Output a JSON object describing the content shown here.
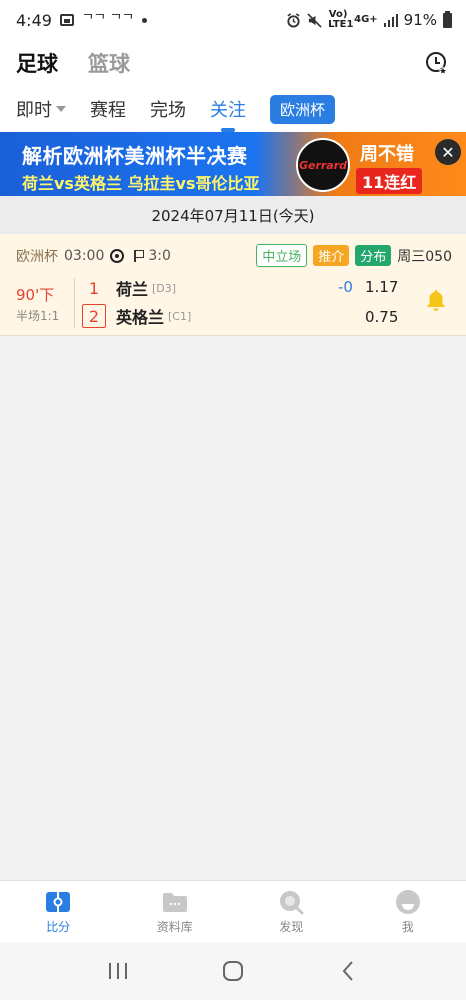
{
  "status_bar": {
    "time": "4:49",
    "carrier_label": "ᄀᄀ ᄀᄀ",
    "battery": "91%",
    "network_volte": "Vo) LTE1",
    "network_4g": "4G+"
  },
  "top_nav": {
    "tabs": [
      {
        "label": "足球"
      },
      {
        "label": "篮球"
      }
    ]
  },
  "sub_tabs": {
    "tabs": [
      {
        "label": "即时"
      },
      {
        "label": "赛程"
      },
      {
        "label": "完场"
      },
      {
        "label": "关注"
      }
    ],
    "chip": "欧洲杯"
  },
  "banner": {
    "line1": "解析欧洲杯美洲杯半决赛",
    "line2": "荷兰vs英格兰 乌拉圭vs哥伦比亚",
    "logo_text": "Gerrard",
    "right1": "周不错",
    "right2": "11连红"
  },
  "date_header": "2024年07月11日(今天)",
  "match": {
    "league": "欧洲杯",
    "time": "03:00",
    "corners": "3:0",
    "badges": [
      "中立场",
      "推介",
      "分布"
    ],
    "match_no": "周三050",
    "minute": "90'下",
    "halftime": "半场1:1",
    "home": {
      "score": "1",
      "name": "荷兰",
      "rank": "[D3]"
    },
    "away": {
      "score": "2",
      "name": "英格兰",
      "rank": "[C1]"
    },
    "handicap": "-0",
    "odds_home": "1.17",
    "odds_away": "0.75"
  },
  "bottom_nav": {
    "items": [
      {
        "label": "比分"
      },
      {
        "label": "资料库"
      },
      {
        "label": "发现"
      },
      {
        "label": "我"
      }
    ]
  },
  "colors": {
    "accent": "#2a7de1",
    "live_red": "#e5432f",
    "card_bg": "#fff6e6"
  }
}
